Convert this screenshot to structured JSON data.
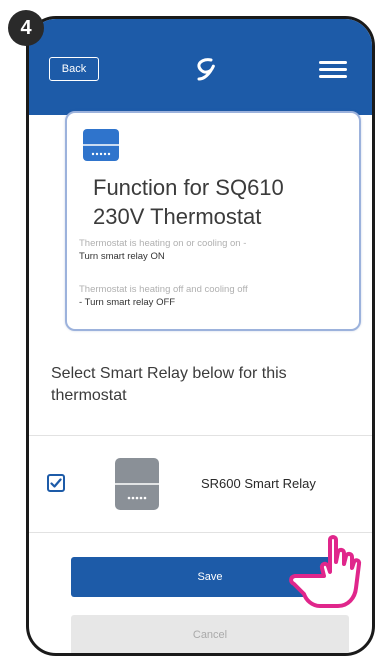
{
  "step": {
    "number": "4"
  },
  "header": {
    "back_label": "Back"
  },
  "function_card": {
    "title_line1": "Function for SQ610",
    "title_line2": "230V Thermostat",
    "on_condition": "Thermostat is heating on or cooling on -",
    "on_action": "Turn smart relay ON",
    "off_condition": "Thermostat is heating off and cooling off",
    "off_action": "- Turn smart relay OFF"
  },
  "instruction": "Select Smart Relay below for this thermostat",
  "relay_list": [
    {
      "name": "SR600 Smart Relay",
      "checked": true
    }
  ],
  "actions": {
    "save_label": "Save",
    "cancel_label": "Cancel"
  },
  "colors": {
    "primary": "#1d5ba8",
    "card_border": "#9cb2dc",
    "hand_outline": "#e0268b",
    "disabled": "#e7e7e7"
  }
}
